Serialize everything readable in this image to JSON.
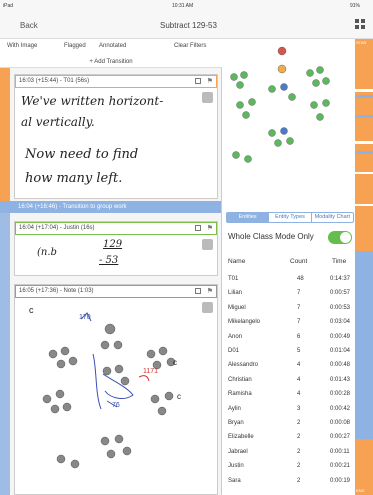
{
  "status": {
    "carrier": "iPad",
    "time": "10:31 AM",
    "battery": "91%"
  },
  "nav": {
    "back": "Back",
    "title": "Subtract 129-53"
  },
  "filters": {
    "with_image": "With Image",
    "flagged": "Flagged",
    "annotated": "Annotated",
    "clear": "Clear Filters"
  },
  "add_transition": "+ Add Transition",
  "entries": [
    {
      "header": "16:03 (+15:44) - T01 (56s)",
      "handwriting": [
        "We've written horizont-",
        "al vertically.",
        "Now need to find",
        "how many left."
      ]
    },
    {
      "transition": "16:04 (+16:46) - Transition to group work"
    },
    {
      "header": "16:04 (+17:04) - Justin (16s)",
      "handwriting": [
        "(n.b",
        "129",
        "- 53"
      ]
    },
    {
      "header": "16:05 (+17:36) - Note (1:03)"
    }
  ],
  "tabs": [
    "Entities",
    "Entity Types",
    "Modality Chart"
  ],
  "whole_class": "Whole Class Mode Only",
  "columns": {
    "name": "Name",
    "count": "Count",
    "time": "Time"
  },
  "rows": [
    {
      "name": "T01",
      "count": "48",
      "time": "0:14:37"
    },
    {
      "name": "Lilian",
      "count": "7",
      "time": "0:00:57"
    },
    {
      "name": "Miguel",
      "count": "7",
      "time": "0:00:53"
    },
    {
      "name": "Mikelangelo",
      "count": "7",
      "time": "0:03:04"
    },
    {
      "name": "Anon",
      "count": "6",
      "time": "0:00:49"
    },
    {
      "name": "D01",
      "count": "5",
      "time": "0:01:04"
    },
    {
      "name": "Alessandro",
      "count": "4",
      "time": "0:00:48"
    },
    {
      "name": "Christian",
      "count": "4",
      "time": "0:01:43"
    },
    {
      "name": "Ramisha",
      "count": "4",
      "time": "0:00:28"
    },
    {
      "name": "Aylin",
      "count": "3",
      "time": "0:00:42"
    },
    {
      "name": "Bryan",
      "count": "2",
      "time": "0:00:08"
    },
    {
      "name": "Elizabelle",
      "count": "2",
      "time": "0:00:27"
    },
    {
      "name": "Jabrael",
      "count": "2",
      "time": "0:00:11"
    },
    {
      "name": "Justin",
      "count": "2",
      "time": "0:00:21"
    },
    {
      "name": "Sara",
      "count": "2",
      "time": "0:00:19"
    }
  ],
  "rail": {
    "start": "STAR",
    "end": "END"
  },
  "colors": {
    "accent_orange": "#f7a153",
    "accent_blue": "#8eb2e2",
    "accent_green": "#7bbf4b",
    "toggle_on": "#64bd4d"
  }
}
